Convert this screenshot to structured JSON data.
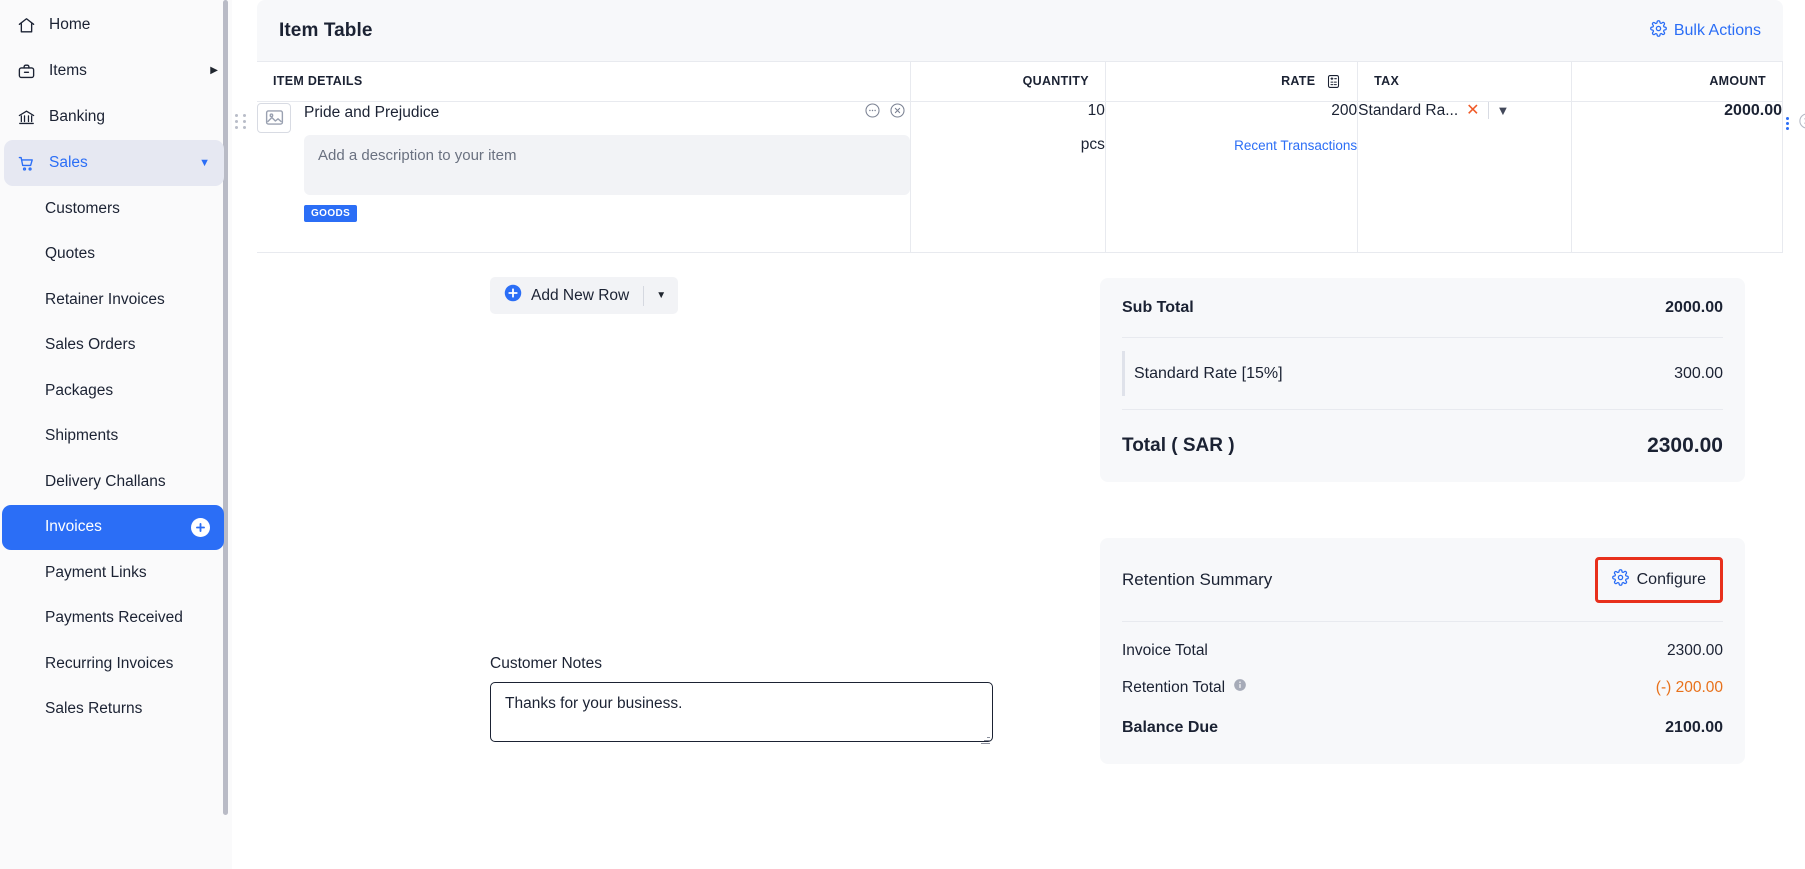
{
  "sidebar": {
    "top_items": [
      {
        "label": "Home",
        "icon": "home-icon",
        "trailing": ""
      },
      {
        "label": "Items",
        "icon": "briefcase-icon",
        "trailing": "chevron-right"
      },
      {
        "label": "Banking",
        "icon": "bank-icon",
        "trailing": ""
      },
      {
        "label": "Sales",
        "icon": "cart-icon",
        "trailing": "chevron-down"
      }
    ],
    "sub_items": [
      {
        "label": "Customers"
      },
      {
        "label": "Quotes"
      },
      {
        "label": "Retainer Invoices"
      },
      {
        "label": "Sales Orders"
      },
      {
        "label": "Packages"
      },
      {
        "label": "Shipments"
      },
      {
        "label": "Delivery Challans"
      },
      {
        "label": "Invoices",
        "selected": true,
        "badge": "plus-icon"
      },
      {
        "label": "Payment Links"
      },
      {
        "label": "Payments Received"
      },
      {
        "label": "Recurring Invoices"
      },
      {
        "label": "Sales Returns"
      }
    ],
    "active_accent": "#2b6ef6"
  },
  "panel": {
    "title": "Item Table",
    "bulk_actions_label": "Bulk Actions"
  },
  "table": {
    "headers": {
      "details": "ITEM DETAILS",
      "quantity": "QUANTITY",
      "rate": "RATE",
      "tax": "TAX",
      "amount": "AMOUNT"
    },
    "rows": [
      {
        "name": "Pride and Prejudice",
        "description_placeholder": "Add a description to your item",
        "badge": "GOODS",
        "quantity": "10",
        "unit": "pcs",
        "rate": "200",
        "recent_transactions_label": "Recent Transactions",
        "tax": "Standard Ra...",
        "amount": "2000.00"
      }
    ]
  },
  "add_row": {
    "label": "Add New Row"
  },
  "totals": {
    "sub_total_label": "Sub Total",
    "sub_total_value": "2000.00",
    "tax_label": "Standard Rate [15%]",
    "tax_value": "300.00",
    "grand_label": "Total ( SAR )",
    "grand_value": "2300.00"
  },
  "retention": {
    "title": "Retention Summary",
    "configure_label": "Configure",
    "highlight_color": "#e8301c",
    "rows": [
      {
        "label": "Invoice Total",
        "value": "2300.00",
        "negative": false,
        "info": false
      },
      {
        "label": "Retention Total",
        "value": "(-) 200.00",
        "negative": true,
        "info": true
      },
      {
        "label": "Balance Due",
        "value": "2100.00",
        "negative": false,
        "info": false,
        "bold": true
      }
    ]
  },
  "notes": {
    "label": "Customer Notes",
    "value": "Thanks for your business."
  }
}
